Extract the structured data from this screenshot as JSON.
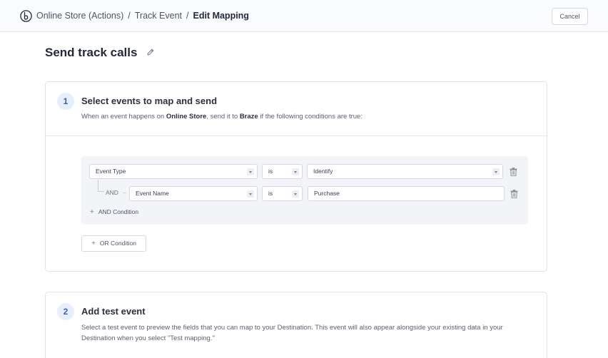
{
  "header": {
    "breadcrumb": [
      "Online Store (Actions)",
      "Track Event",
      "Edit Mapping"
    ],
    "separator": "/",
    "cancel_label": "Cancel"
  },
  "page": {
    "title": "Send track calls"
  },
  "step1": {
    "number": "1",
    "title": "Select events to map and send",
    "desc_prefix": "When an event happens on ",
    "source_name": "Online Store",
    "desc_middle": ", send it to ",
    "destination_name": "Braze",
    "desc_suffix": " if the following conditions are true:",
    "conditions": [
      {
        "field": "Event Type",
        "operator": "is",
        "value": "Identify"
      },
      {
        "connector": "AND",
        "field": "Event Name",
        "operator": "is",
        "value": "Purchase"
      }
    ],
    "add_and_label": "AND Condition",
    "add_or_label": "OR Condition",
    "plus": "+"
  },
  "step2": {
    "number": "2",
    "title": "Add test event",
    "desc": "Select a test event to preview the fields that you can map to your Destination. This event will also appear alongside your existing data in your Destination when you select \"Test mapping.\""
  },
  "icons": [
    "brand-logo-icon",
    "pencil-icon",
    "chevron-down-icon",
    "trash-icon",
    "plus-icon"
  ]
}
